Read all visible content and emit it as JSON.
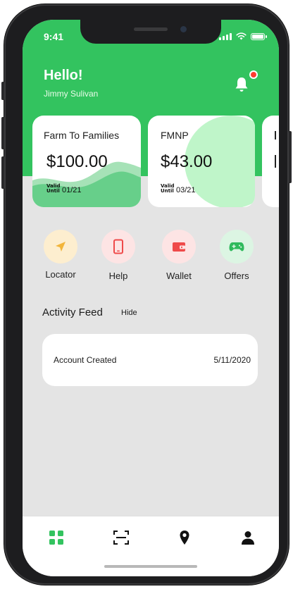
{
  "status_bar": {
    "time": "9:41"
  },
  "header": {
    "greeting": "Hello!",
    "username": "Jimmy Sulivan",
    "notification_badge": true
  },
  "cards": [
    {
      "title": "Farm To Families",
      "amount": "$100.00",
      "valid_label": "Valid Until",
      "valid_until": "01/21"
    },
    {
      "title": "FMNP",
      "amount": "$43.00",
      "valid_label": "Valid Until",
      "valid_until": "03/21"
    }
  ],
  "actions": [
    {
      "label": "Locator",
      "icon": "send-icon",
      "bg": "#fdeecf",
      "color": "#f2b53a"
    },
    {
      "label": "Help",
      "icon": "phone-icon",
      "bg": "#fde4e4",
      "color": "#ef4a4a"
    },
    {
      "label": "Wallet",
      "icon": "wallet-icon",
      "bg": "#fde4e4",
      "color": "#ef4a4a"
    },
    {
      "label": "Offers",
      "icon": "gamepad-icon",
      "bg": "#dcf5e3",
      "color": "#2fba5c"
    }
  ],
  "activity_feed": {
    "title": "Activity Feed",
    "hide_label": "Hide",
    "items": [
      {
        "description": "Account Created",
        "date": "5/11/2020"
      }
    ]
  },
  "tabbar": {
    "tabs": [
      {
        "icon": "grid-icon",
        "active": true
      },
      {
        "icon": "scan-icon",
        "active": false
      },
      {
        "icon": "location-pin-icon",
        "active": false
      },
      {
        "icon": "user-icon",
        "active": false
      }
    ]
  },
  "colors": {
    "brand_green": "#33c35f",
    "card_wave": "#67cf8a",
    "card_circle": "#bff5c9",
    "text_dark": "#1b1b1b"
  }
}
